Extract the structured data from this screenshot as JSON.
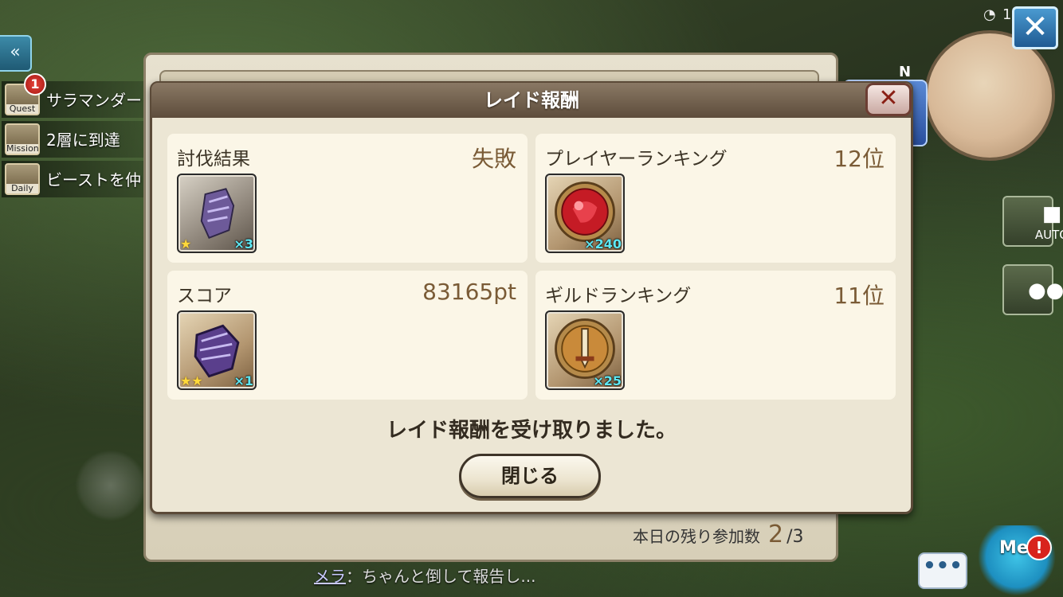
{
  "hud": {
    "back_glyph": "«",
    "quest_rows": [
      {
        "icon_label": "Quest",
        "text": "サラマンダー"
      },
      {
        "icon_label": "Mission",
        "text": "2層に到達"
      },
      {
        "icon_label": "Daily",
        "text": "ビーストを仲"
      }
    ],
    "quest_badge": "1",
    "close_glyph": "✕",
    "clock_value": "1",
    "compass_label": "N",
    "auto_label": "AUTO",
    "chat_dots": "•••",
    "mascot_label": "Me",
    "mascot_alert": "!",
    "chat_speaker": "メラ",
    "chat_message": "：ちゃんと倒して報告し..."
  },
  "back_panel": {
    "remaining_label": "本日の残り参加数",
    "remaining_current": "2",
    "remaining_separator": "/",
    "remaining_total": "3"
  },
  "dialog": {
    "title": "レイド報酬",
    "close_glyph": "✕",
    "cells": [
      {
        "title": "討伐結果",
        "value": "失敗",
        "item": {
          "icon": "purple-cloth-icon",
          "stars": "★",
          "qty": "×3"
        }
      },
      {
        "title": "プレイヤーランキング",
        "value": "12位",
        "item": {
          "icon": "red-gem-medal-icon",
          "stars": "",
          "qty": "×240"
        }
      },
      {
        "title": "スコア",
        "value": "83165pt",
        "item": {
          "icon": "purple-cloth-bundle-icon",
          "stars": "★★",
          "qty": "×1"
        }
      },
      {
        "title": "ギルドランキング",
        "value": "11位",
        "item": {
          "icon": "sword-medal-icon",
          "stars": "",
          "qty": "×25"
        }
      }
    ],
    "message": "レイド報酬を受け取りました。",
    "close_button": "閉じる"
  },
  "colors": {
    "dialog_bg": "#ece6d4",
    "cell_bg": "#fbf6e7",
    "value_text": "#7a5b36",
    "header_bg": "#6f5d4a",
    "qty_text": "#5ee8f4",
    "star": "#ffd93b"
  }
}
